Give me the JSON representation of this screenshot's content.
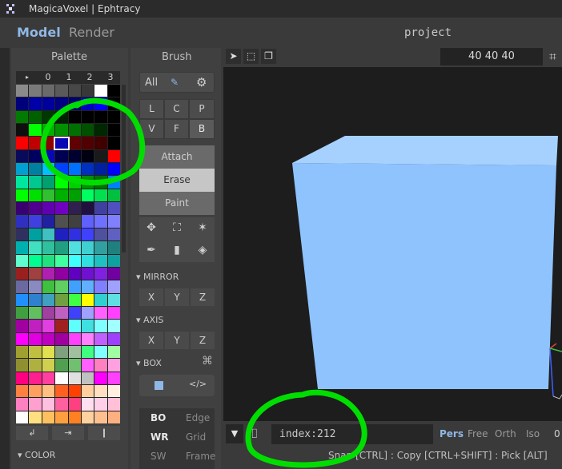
{
  "window": {
    "title": "MagicaVoxel | Ephtracy"
  },
  "tabs": {
    "model": "Model",
    "render": "Render"
  },
  "project": {
    "name": "project"
  },
  "palette": {
    "title": "Palette",
    "page_tabs": [
      "▸",
      "0",
      "1",
      "2",
      "3"
    ],
    "colors": [
      [
        "#8a8a8a",
        "#7a7a7a",
        "#6a6a6a",
        "#5a5a5a",
        "#484848",
        "#383838",
        "#ffffff",
        "#000000"
      ],
      [
        "#00007a",
        "#0000a8",
        "#00009a",
        "#000080",
        "#000070",
        "#0000c0",
        "#0000ff",
        "#000000"
      ],
      [
        "#007a00",
        "#006000",
        "#003800",
        "#002000",
        "#000000",
        "#000000",
        "#000000",
        "#000000"
      ],
      [
        "#0f0f0f",
        "#00ff00",
        "#00b000",
        "#009000",
        "#007000",
        "#005000",
        "#002800",
        "#000000"
      ],
      [
        "#ff0000",
        "#c00000",
        "#900000",
        "#700000",
        "#600000",
        "#500000",
        "#400000",
        "#000000"
      ],
      [
        "#0a0a5a",
        "#000060",
        "#0a08b5",
        "#000050",
        "#000030",
        "#000010",
        "#1a1a1a",
        "#ff0000"
      ],
      [
        "#00a0d0",
        "#0080a0",
        "#00c0ff",
        "#0040ff",
        "#0070ff",
        "#0030c0",
        "#0020a0",
        "#0000ff"
      ],
      [
        "#00e8a0",
        "#00c890",
        "#00a070",
        "#00ff00",
        "#00d000",
        "#009000",
        "#007000",
        "#0080ff"
      ],
      [
        "#00ff00",
        "#00e000",
        "#30c030",
        "#00b000",
        "#00a000",
        "#00ff60",
        "#00e050",
        "#00c040"
      ],
      [
        "#3a0070",
        "#500090",
        "#6000b0",
        "#7000c0",
        "#302050",
        "#201040",
        "#4040a0",
        "#5050c0"
      ],
      [
        "#3030c0",
        "#4040e0",
        "#2020a0",
        "#505050",
        "#404040",
        "#6060ff",
        "#7070ff",
        "#8080ff"
      ],
      [
        "#303060",
        "#00a0a0",
        "#40c0c0",
        "#2020c0",
        "#3030e0",
        "#4040ff",
        "#5050a0",
        "#6060c0"
      ],
      [
        "#00b0b0",
        "#40e0c0",
        "#30c0a0",
        "#20a080",
        "#50e0e0",
        "#40d0d0",
        "#30a0a0",
        "#208080"
      ],
      [
        "#60ffd0",
        "#00ff90",
        "#20e080",
        "#40ffa0",
        "#40ffff",
        "#30e0e0",
        "#20c0c0",
        "#10a0a0"
      ],
      [
        "#9a2020",
        "#a04040",
        "#b020b0",
        "#9000a0",
        "#6000c0",
        "#7010d0",
        "#8020e0",
        "#7000a0"
      ],
      [
        "#6a6aa0",
        "#8a8ac0",
        "#40c040",
        "#60d060",
        "#40a0ff",
        "#60b0ff",
        "#8080ff",
        "#a0a0ff"
      ],
      [
        "#2090ff",
        "#3080d0",
        "#40a0c0",
        "#70a040",
        "#40ff40",
        "#ffff00",
        "#30d0d0",
        "#60e0e0"
      ],
      [
        "#40a040",
        "#60c060",
        "#a040a0",
        "#c060c0",
        "#4040ff",
        "#a0a0ff",
        "#ff60ff",
        "#ff40ff"
      ],
      [
        "#a000a0",
        "#c020c0",
        "#e040e0",
        "#a02020",
        "#60ffff",
        "#40e0e0",
        "#80ffff",
        "#a0ffff"
      ],
      [
        "#ff00ff",
        "#e000e0",
        "#c000c0",
        "#a000a0",
        "#ff40ff",
        "#ff80ff",
        "#c060ff",
        "#a040ff"
      ],
      [
        "#a0a030",
        "#c0c040",
        "#e0e050",
        "#80a080",
        "#a0c0a0",
        "#40ff80",
        "#80ffff",
        "#a0ffa0"
      ],
      [
        "#909030",
        "#b0b040",
        "#d0d050",
        "#50a050",
        "#70c070",
        "#ff60ff",
        "#ff80c0",
        "#ffa0e0"
      ],
      [
        "#ff0080",
        "#ff2090",
        "#ff40a0",
        "#ffffff",
        "#e0e0e0",
        "#c0c0c0",
        "#ff00ff",
        "#ff40ff"
      ],
      [
        "#ff8040",
        "#ffa060",
        "#ffc080",
        "#ff6020",
        "#ff4000",
        "#ffd0a0",
        "#ffe0c0",
        "#fff0e0"
      ],
      [
        "#ff80c0",
        "#ffa0d0",
        "#ffc0e0",
        "#ff60a0",
        "#ff4080",
        "#ffe0f0",
        "#ffd0e8",
        "#ffc0d8"
      ],
      [
        "#ffffff",
        "#ffe080",
        "#ffc060",
        "#ffa040",
        "#ff8020",
        "#ffd0a0",
        "#ffc090",
        "#ffb080"
      ]
    ],
    "footer_buttons": [
      "↲",
      "⇥",
      "❙"
    ],
    "color_section": "COLOR"
  },
  "brush": {
    "title": "Brush",
    "all_label": "All",
    "types": [
      [
        "L",
        "C",
        "P"
      ],
      [
        "V",
        "F",
        "B"
      ]
    ],
    "modes": [
      "Attach",
      "Erase",
      "Paint"
    ],
    "mirror": {
      "label": "MIRROR",
      "axes": [
        "X",
        "Y",
        "Z"
      ]
    },
    "axis": {
      "label": "AXIS",
      "axes": [
        "X",
        "Y",
        "Z"
      ]
    },
    "box": {
      "label": "BOX"
    },
    "display": [
      {
        "key": "BO",
        "value": "Edge"
      },
      {
        "key": "WR",
        "value": "Grid"
      },
      {
        "key": "SW",
        "value": "Frame"
      }
    ]
  },
  "viewport": {
    "dimensions": "40  40  40",
    "cube_color": "#8ec3fe",
    "index_label": "index:212",
    "camera_modes": [
      "Pers",
      "Free",
      "Orth",
      "Iso",
      "0"
    ],
    "hint": "Snap [CTRL] : Copy [CTRL+SHIFT] : Pick [ALT]"
  },
  "annotations": {
    "color": "#00dd00"
  }
}
